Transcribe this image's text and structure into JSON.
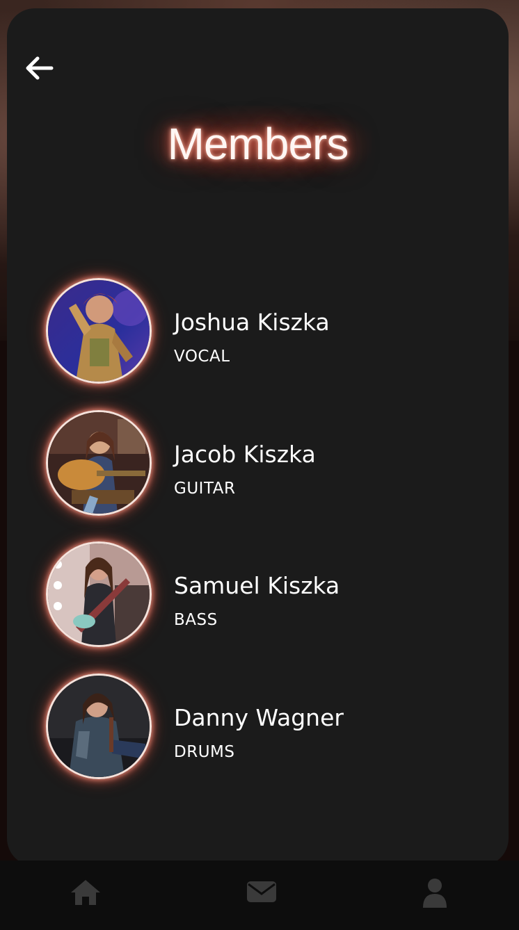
{
  "page": {
    "title": "Members",
    "accent_color": "#e0604a"
  },
  "navigation": {
    "back_icon": "arrow-left-icon"
  },
  "members": [
    {
      "name": "Joshua Kiszka",
      "role": "VOCAL"
    },
    {
      "name": "Jacob Kiszka",
      "role": "GUITAR"
    },
    {
      "name": "Samuel Kiszka",
      "role": "BASS"
    },
    {
      "name": "Danny Wagner",
      "role": "DRUMS"
    }
  ],
  "bottom_nav": {
    "items": [
      {
        "icon": "home-icon"
      },
      {
        "icon": "envelope-icon"
      },
      {
        "icon": "user-icon"
      }
    ]
  }
}
